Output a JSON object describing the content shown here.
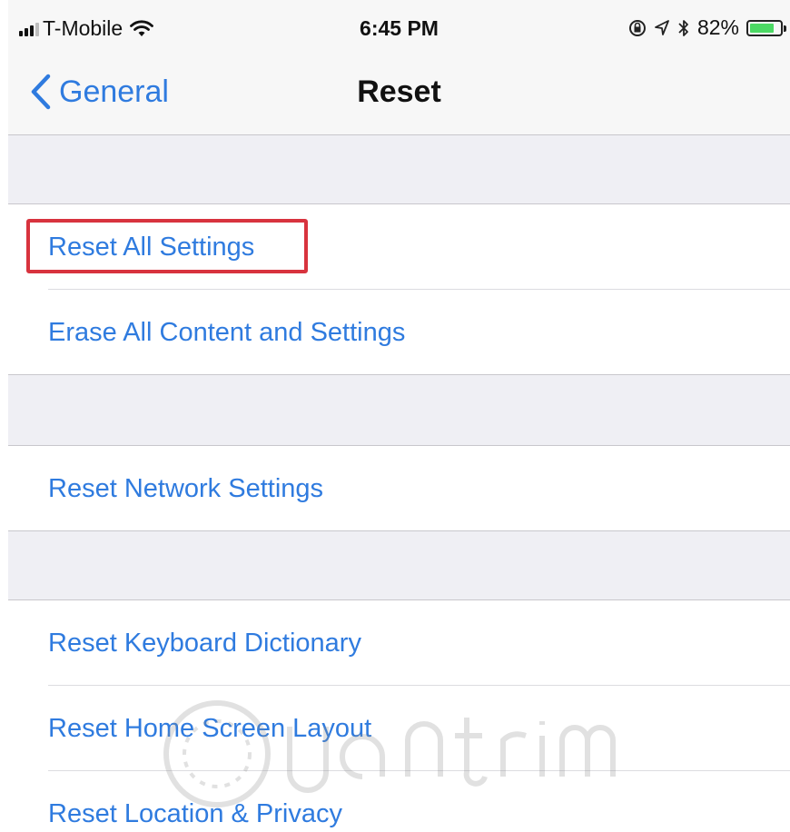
{
  "status_bar": {
    "carrier": "T-Mobile",
    "time": "6:45 PM",
    "battery_percent": "82%",
    "battery_level": 0.82,
    "icons": [
      "signal-icon",
      "wifi-icon",
      "screen-rotation-lock-icon",
      "location-icon",
      "bluetooth-icon",
      "battery-icon"
    ]
  },
  "nav": {
    "back_label": "General",
    "title": "Reset"
  },
  "groups": [
    {
      "rows": [
        "Reset All Settings",
        "Erase All Content and Settings"
      ]
    },
    {
      "rows": [
        "Reset Network Settings"
      ]
    },
    {
      "rows": [
        "Reset Keyboard Dictionary",
        "Reset Home Screen Layout",
        "Reset Location & Privacy"
      ]
    }
  ],
  "highlight": {
    "target": "Reset All Settings",
    "color": "#d8333e"
  },
  "colors": {
    "link_blue": "#2f7bdf",
    "group_background": "#efeff4",
    "bar_background": "#f7f7f7",
    "battery_green": "#4cd964"
  }
}
